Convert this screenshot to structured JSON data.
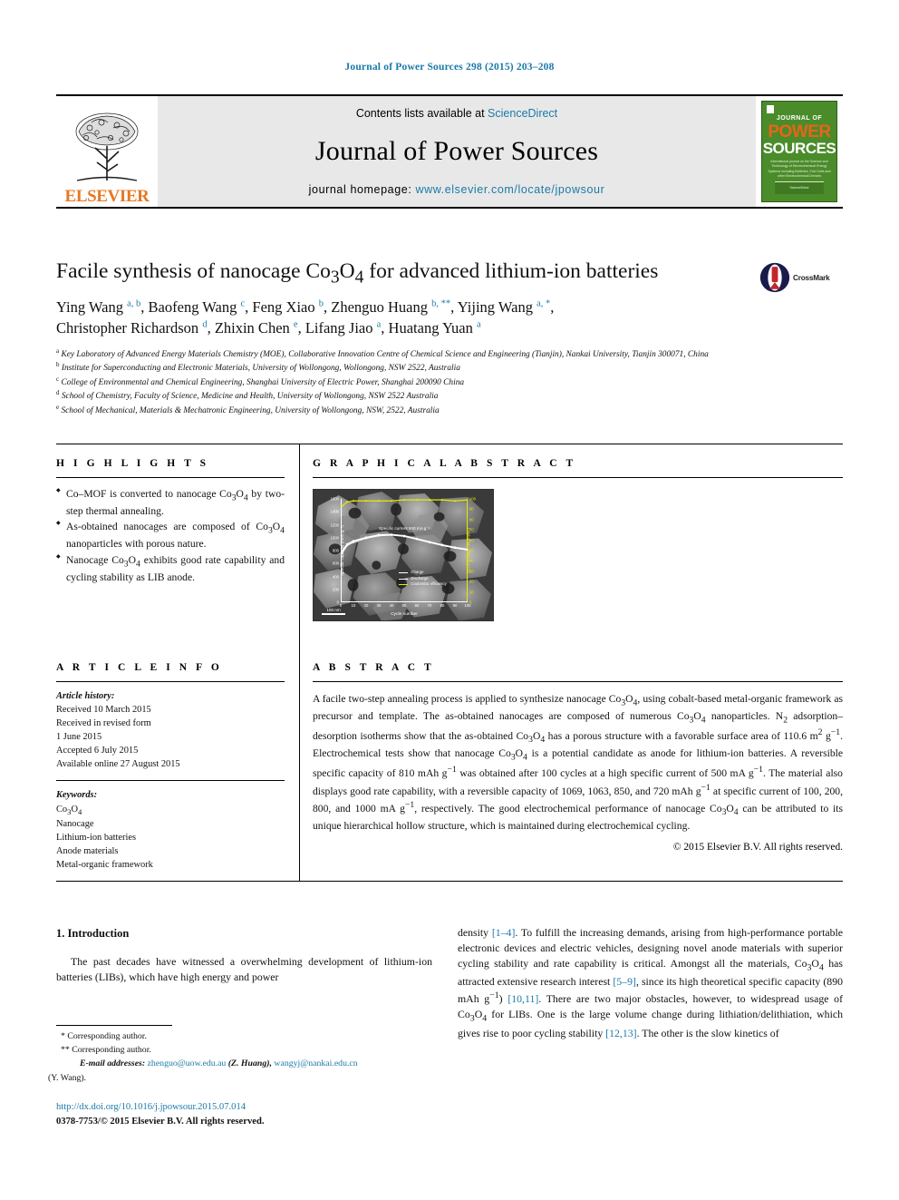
{
  "running_head": "Journal of Power Sources 298 (2015) 203–208",
  "masthead": {
    "contents_prefix": "Contents lists available at ",
    "sciencedirect": "ScienceDirect",
    "journal_title": "Journal of Power Sources",
    "homepage_prefix": "journal homepage: ",
    "homepage_url": "www.elsevier.com/locate/jpowsour",
    "publisher": "ELSEVIER",
    "cover": {
      "line1": "JOURNAL OF",
      "line2": "POWER",
      "line3": "SOURCES",
      "blurb": "International journal on the Science and Technology of Electrochemical Energy Systems including Batteries, Fuel Cells and other Electrochemical Devices",
      "footer": "ScienceDirect"
    },
    "accent_link_color": "#1a7aa8",
    "elsevier_orange": "#E87722",
    "cover_green": "#4a8c2a"
  },
  "article": {
    "title": "Facile synthesis of nanocage Co3O4 for advanced lithium-ion batteries",
    "crossmark_label": "CrossMark",
    "authors_line1": "Ying Wang <sup>a, b</sup>, Baofeng Wang <sup>c</sup>, Feng Xiao <sup>b</sup>, Zhenguo Huang <sup>b, **</sup>, Yijing Wang <sup>a, *</sup>,",
    "authors_line2": "Christopher Richardson <sup>d</sup>, Zhixin Chen <sup>e</sup>, Lifang Jiao <sup>a</sup>, Huatang Yuan <sup>a</sup>",
    "affiliations": [
      "<sup>a</sup> Key Laboratory of Advanced Energy Materials Chemistry (MOE), Collaborative Innovation Centre of Chemical Science and Engineering (Tianjin), Nankai University, Tianjin 300071, China",
      "<sup>b</sup> Institute for Superconducting and Electronic Materials, University of Wollongong, Wollongong, NSW 2522, Australia",
      "<sup>c</sup> College of Environmental and Chemical Engineering, Shanghai University of Electric Power, Shanghai 200090 China",
      "<sup>d</sup> School of Chemistry, Faculty of Science, Medicine and Health, University of Wollongong, NSW 2522 Australia",
      "<sup>e</sup> School of Mechanical, Materials & Mechatronic Engineering, University of Wollongong, NSW, 2522, Australia"
    ]
  },
  "highlights": {
    "heading": "H I G H L I G H T S",
    "items": [
      "Co–MOF is converted to nanocage Co<sub>3</sub>O<sub>4</sub> by two-step thermal annealing.",
      "As-obtained nanocages are composed of Co<sub>3</sub>O<sub>4</sub> nanoparticles with porous nature.",
      "Nanocage Co<sub>3</sub>O<sub>4</sub> exhibits good rate capability and cycling stability as LIB anode."
    ]
  },
  "graphical_abstract": {
    "heading": "G R A P H I C A L   A B S T R A C T",
    "scalebar_label": "100 nm"
  },
  "chart_data": {
    "type": "line",
    "title": "",
    "xlabel": "Cycle number",
    "ylabel": "Specific capacity (mAh g⁻¹)",
    "y2label": "Coulombic efficiency (%)",
    "xlim": [
      0,
      100
    ],
    "ylim": [
      0,
      1600
    ],
    "y2lim": [
      0,
      100
    ],
    "xticks": [
      0,
      10,
      20,
      30,
      40,
      50,
      60,
      70,
      80,
      90,
      100
    ],
    "yticks": [
      0,
      200,
      400,
      600,
      800,
      1000,
      1200,
      1400,
      1600
    ],
    "y2ticks": [
      0,
      10,
      20,
      30,
      40,
      50,
      60,
      70,
      80,
      90,
      100
    ],
    "annotation": "Specific current 500 mA g⁻¹",
    "grid": false,
    "legend_position": "center-bottom",
    "series": [
      {
        "name": "Charge",
        "color": "#ffffff",
        "x": [
          1,
          5,
          10,
          20,
          30,
          40,
          50,
          60,
          70,
          80,
          90,
          100
        ],
        "values": [
          760,
          880,
          930,
          990,
          1030,
          1040,
          1020,
          975,
          925,
          880,
          840,
          810
        ]
      },
      {
        "name": "Discharge",
        "color": "#ffffff",
        "x": [
          1,
          5,
          10,
          20,
          30,
          40,
          50,
          60,
          70,
          80,
          90,
          100
        ],
        "values": [
          790,
          900,
          950,
          1005,
          1045,
          1050,
          1030,
          985,
          935,
          890,
          850,
          820
        ]
      },
      {
        "name": "Coulombic efficiency",
        "color": "#e9e805",
        "axis": "right",
        "x": [
          1,
          5,
          10,
          20,
          30,
          40,
          50,
          60,
          70,
          80,
          90,
          100
        ],
        "values": [
          93,
          97,
          98,
          98,
          98,
          98,
          99,
          99,
          99,
          99,
          98,
          99
        ]
      }
    ]
  },
  "article_info": {
    "heading": "A R T I C L E   I N F O",
    "history_label": "Article history:",
    "history": [
      "Received 10 March 2015",
      "Received in revised form",
      "1 June 2015",
      "Accepted 6 July 2015",
      "Available online 27 August 2015"
    ],
    "keywords_label": "Keywords:",
    "keywords": [
      "Co<sub>3</sub>O<sub>4</sub>",
      "Nanocage",
      "Lithium-ion batteries",
      "Anode materials",
      "Metal-organic framework"
    ]
  },
  "abstract": {
    "heading": "A B S T R A C T",
    "text": "A facile two-step annealing process is applied to synthesize nanocage Co<sub>3</sub>O<sub>4</sub>, using cobalt-based metal-organic framework as precursor and template. The as-obtained nanocages are composed of numerous Co<sub>3</sub>O<sub>4</sub> nanoparticles. N<sub>2</sub> adsorption–desorption isotherms show that the as-obtained Co<sub>3</sub>O<sub>4</sub> has a porous structure with a favorable surface area of 110.6 m<sup>2</sup> g<sup>−1</sup>. Electrochemical tests show that nanocage Co<sub>3</sub>O<sub>4</sub> is a potential candidate as anode for lithium-ion batteries. A reversible specific capacity of 810 mAh g<sup>−1</sup> was obtained after 100 cycles at a high specific current of 500 mA g<sup>−1</sup>. The material also displays good rate capability, with a reversible capacity of 1069, 1063, 850, and 720 mAh g<sup>−1</sup> at specific current of 100, 200, 800, and 1000 mA g<sup>−1</sup>, respectively. The good electrochemical performance of nanocage Co<sub>3</sub>O<sub>4</sub> can be attributed to its unique hierarchical hollow structure, which is maintained during electrochemical cycling.",
    "copyright": "© 2015 Elsevier B.V. All rights reserved."
  },
  "body": {
    "section_heading": "1. Introduction",
    "left_paragraph": "The past decades have witnessed a overwhelming development of lithium-ion batteries (LIBs), which have high energy and power",
    "right_paragraph": "density <span class=\"ref\">[1–4]</span>. To fulfill the increasing demands, arising from high-performance portable electronic devices and electric vehicles, designing novel anode materials with superior cycling stability and rate capability is critical. Amongst all the materials, Co<sub>3</sub>O<sub>4</sub> has attracted extensive research interest <span class=\"ref\">[5–9]</span>, since its high theoretical specific capacity (890 mAh g<sup>−1</sup>) <span class=\"ref\">[10,11]</span>. There are two major obstacles, however, to widespread usage of Co<sub>3</sub>O<sub>4</sub> for LIBs. One is the large volume change during lithiation/delithiation, which gives rise to poor cycling stability <span class=\"ref\">[12,13]</span>. The other is the slow kinetics of"
  },
  "footnotes": {
    "corresponding1": "* Corresponding author.",
    "corresponding2": "** Corresponding author.",
    "email_label": "E-mail addresses:",
    "email1": "zhenguo@uow.edu.au",
    "email1_owner": "(Z. Huang),",
    "email2": "wangyj@nankai.edu.cn",
    "email2_owner": "(Y. Wang)."
  },
  "footer": {
    "doi": "http://dx.doi.org/10.1016/j.jpowsour.2015.07.014",
    "issn": "0378-7753/© 2015 Elsevier B.V. All rights reserved."
  }
}
